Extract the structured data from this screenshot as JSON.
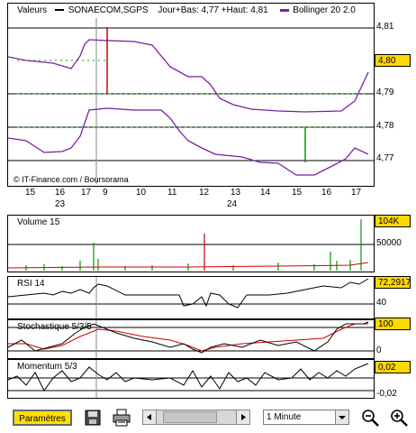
{
  "main_chart": {
    "legend_left": "Valeurs",
    "legend_symbol": "SONAECOM,SGPS",
    "legend_info": "Jour+Bas: 4,77 +Haut: 4,81",
    "legend_bollinger": "Bollinger 20 2.0",
    "copyright": "© IT-Finance.com / Boursorama",
    "y_ticks": [
      "4,81",
      "4,80",
      "4,79",
      "4,78",
      "4,77"
    ],
    "current_price": "4,80",
    "x_day_labels": [
      "15",
      "16",
      "17",
      "9",
      "10",
      "11",
      "12",
      "13",
      "14",
      "15",
      "16",
      "17"
    ],
    "x_month_labels": [
      "23",
      "24"
    ]
  },
  "volume_chart": {
    "label": "Volume 15",
    "current_value": "104K",
    "y_tick": "50000"
  },
  "rsi_chart": {
    "label": "RSI 14",
    "current_value": "72,2917",
    "y_tick": "40"
  },
  "stoch_chart": {
    "label": "Stochastique 5/3/5",
    "current_value": "100",
    "y_tick": "0"
  },
  "momentum_chart": {
    "label": "Momentum 5/3",
    "current_value": "0,02",
    "y_tick": "-0,02"
  },
  "toolbar": {
    "params_label": "Paramètres",
    "interval_selected": "1 Minute"
  },
  "colors": {
    "price": "#000000",
    "bollinger": "#7a1fa2",
    "volume": "#009900",
    "highlight_bar": "#cc0000",
    "tag_yellow": "#ffd800",
    "stoch_signal": "#cc0000"
  },
  "icons": [
    "save-icon",
    "print-icon",
    "scroll-left-icon",
    "scroll-right-icon",
    "dropdown-arrow-icon",
    "zoom-out-icon",
    "zoom-in-icon"
  ]
}
